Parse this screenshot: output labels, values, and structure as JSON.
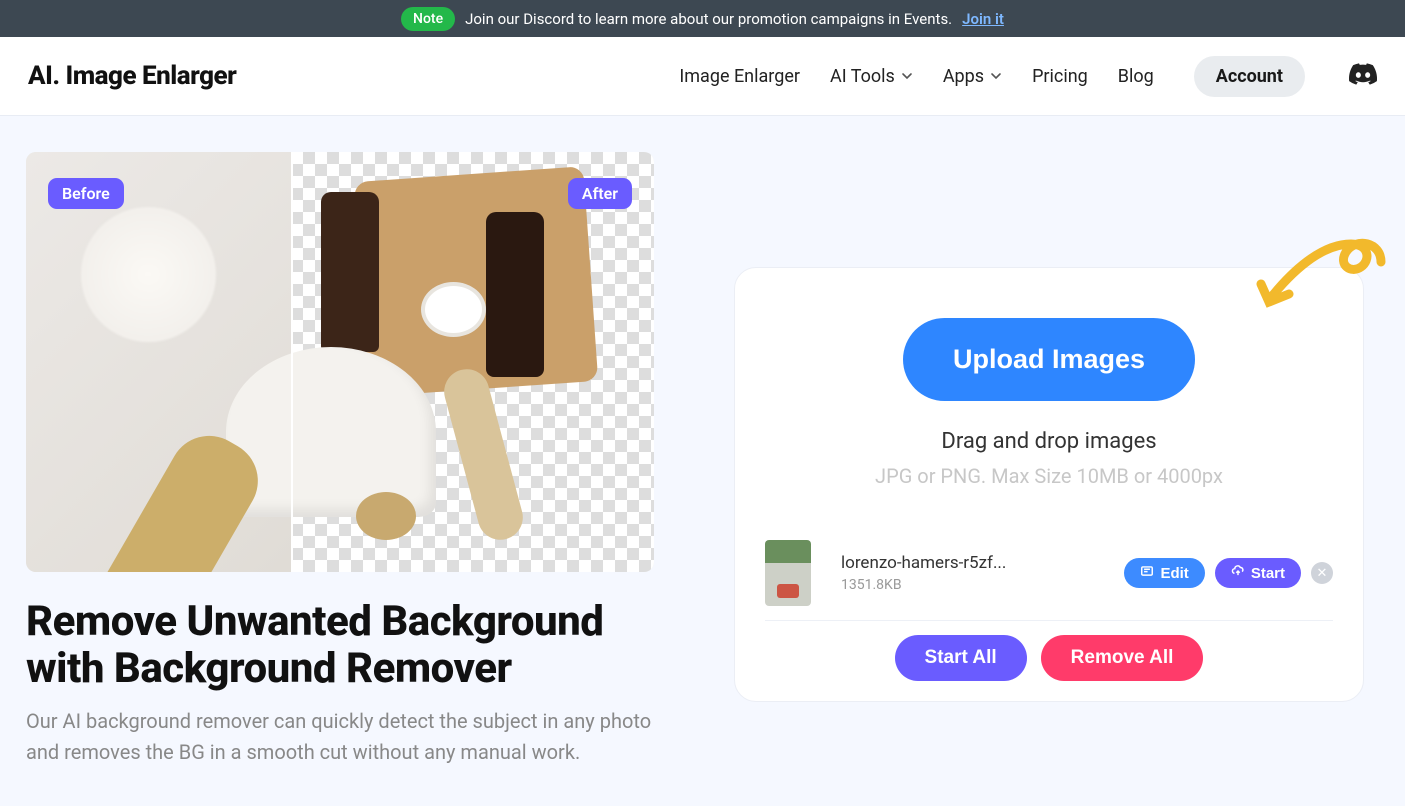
{
  "banner": {
    "note_badge": "Note",
    "text": "Join our Discord to learn more about our promotion campaigns in Events.",
    "link_text": "Join it"
  },
  "nav": {
    "logo": "AI. Image Enlarger",
    "items": [
      "Image Enlarger",
      "AI Tools",
      "Apps",
      "Pricing",
      "Blog"
    ],
    "account": "Account"
  },
  "preview": {
    "before_label": "Before",
    "after_label": "After"
  },
  "hero": {
    "heading": "Remove Unwanted Background with Background Remover",
    "sub": "Our AI background remover can quickly detect the subject in any photo and removes the BG in a smooth cut without any manual work."
  },
  "upload": {
    "button": "Upload Images",
    "drag_text": "Drag and drop images",
    "hint": "JPG or PNG. Max Size 10MB or 4000px",
    "file": {
      "name": "lorenzo-hamers-r5zf...",
      "size": "1351.8KB",
      "edit_label": "Edit",
      "start_label": "Start"
    },
    "start_all": "Start All",
    "remove_all": "Remove All"
  }
}
